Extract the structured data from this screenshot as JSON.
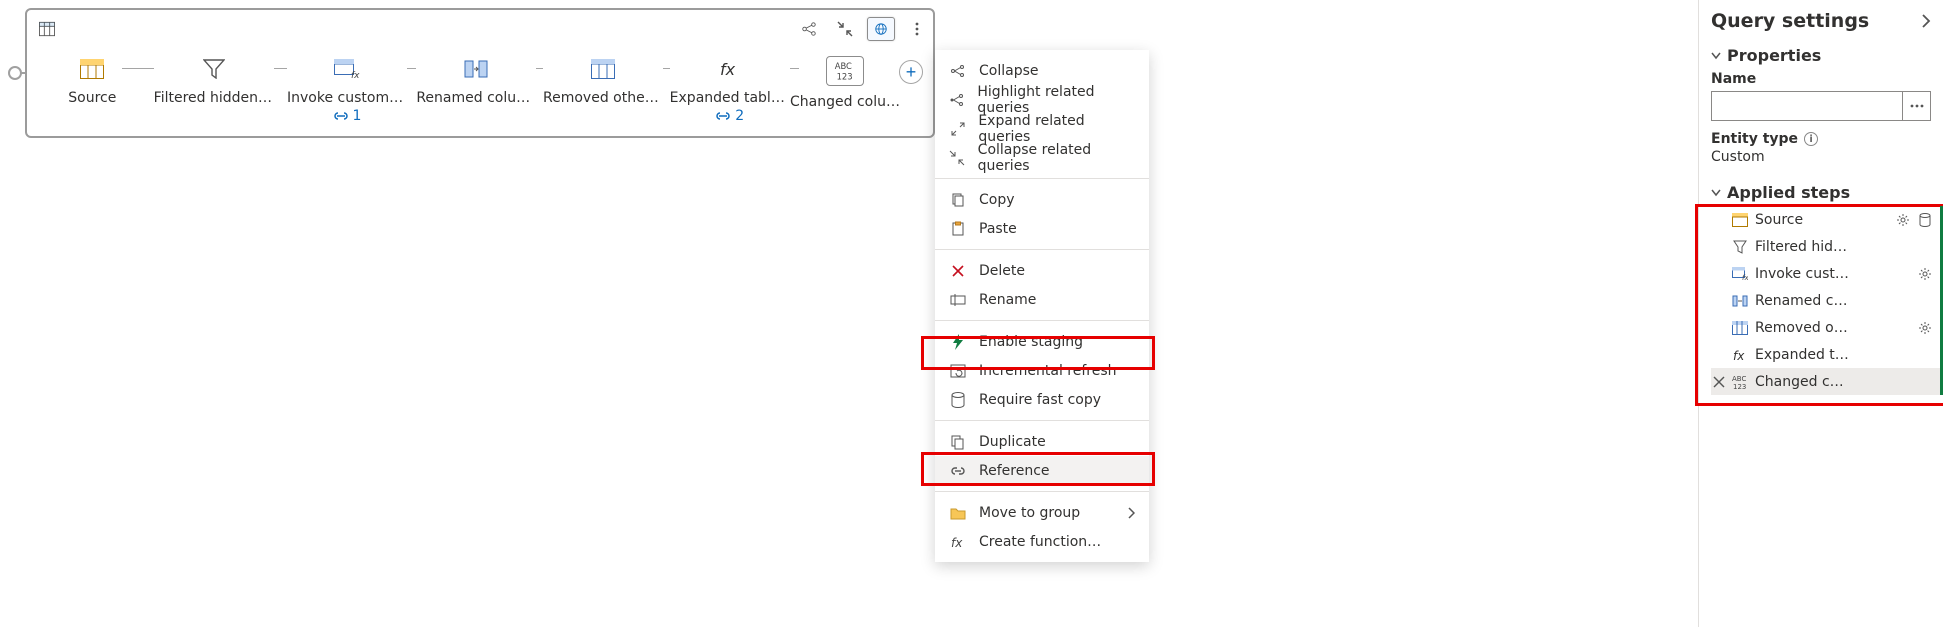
{
  "diagram": {
    "steps": [
      {
        "label": "Source"
      },
      {
        "label": "Filtered hidden fi…"
      },
      {
        "label": "Invoke custom fu…",
        "linkCount": "1"
      },
      {
        "label": "Renamed columns"
      },
      {
        "label": "Removed other c…"
      },
      {
        "label": "Expanded table c…",
        "linkCount": "2"
      },
      {
        "label": "Changed column…"
      }
    ],
    "addTooltip": "+"
  },
  "contextMenu": {
    "items": [
      {
        "key": "collapse",
        "label": "Collapse"
      },
      {
        "key": "highlightRelated",
        "label": "Highlight related queries"
      },
      {
        "key": "expandRelated",
        "label": "Expand related queries"
      },
      {
        "key": "collapseRelated",
        "label": "Collapse related queries"
      },
      {
        "key": "copy",
        "label": "Copy"
      },
      {
        "key": "paste",
        "label": "Paste"
      },
      {
        "key": "delete",
        "label": "Delete"
      },
      {
        "key": "rename",
        "label": "Rename"
      },
      {
        "key": "enableStaging",
        "label": "Enable staging"
      },
      {
        "key": "incrementalRefresh",
        "label": "Incremental refresh"
      },
      {
        "key": "requireFastCopy",
        "label": "Require fast copy"
      },
      {
        "key": "duplicate",
        "label": "Duplicate"
      },
      {
        "key": "reference",
        "label": "Reference"
      },
      {
        "key": "moveToGroup",
        "label": "Move to group",
        "submenu": true
      },
      {
        "key": "createFunction",
        "label": "Create function…"
      }
    ]
  },
  "settings": {
    "title": "Query settings",
    "propertiesTitle": "Properties",
    "nameLabel": "Name",
    "nameValue": "",
    "entityTypeLabel": "Entity type",
    "entityTypeValue": "Custom",
    "appliedStepsTitle": "Applied steps",
    "steps": [
      {
        "label": "Source",
        "gear": true,
        "db": true
      },
      {
        "label": "Filtered hid…"
      },
      {
        "label": "Invoke cust…",
        "gear": true
      },
      {
        "label": "Renamed c…"
      },
      {
        "label": "Removed o…",
        "gear": true
      },
      {
        "label": "Expanded t…"
      },
      {
        "label": "Changed c…",
        "selected": true
      }
    ]
  }
}
